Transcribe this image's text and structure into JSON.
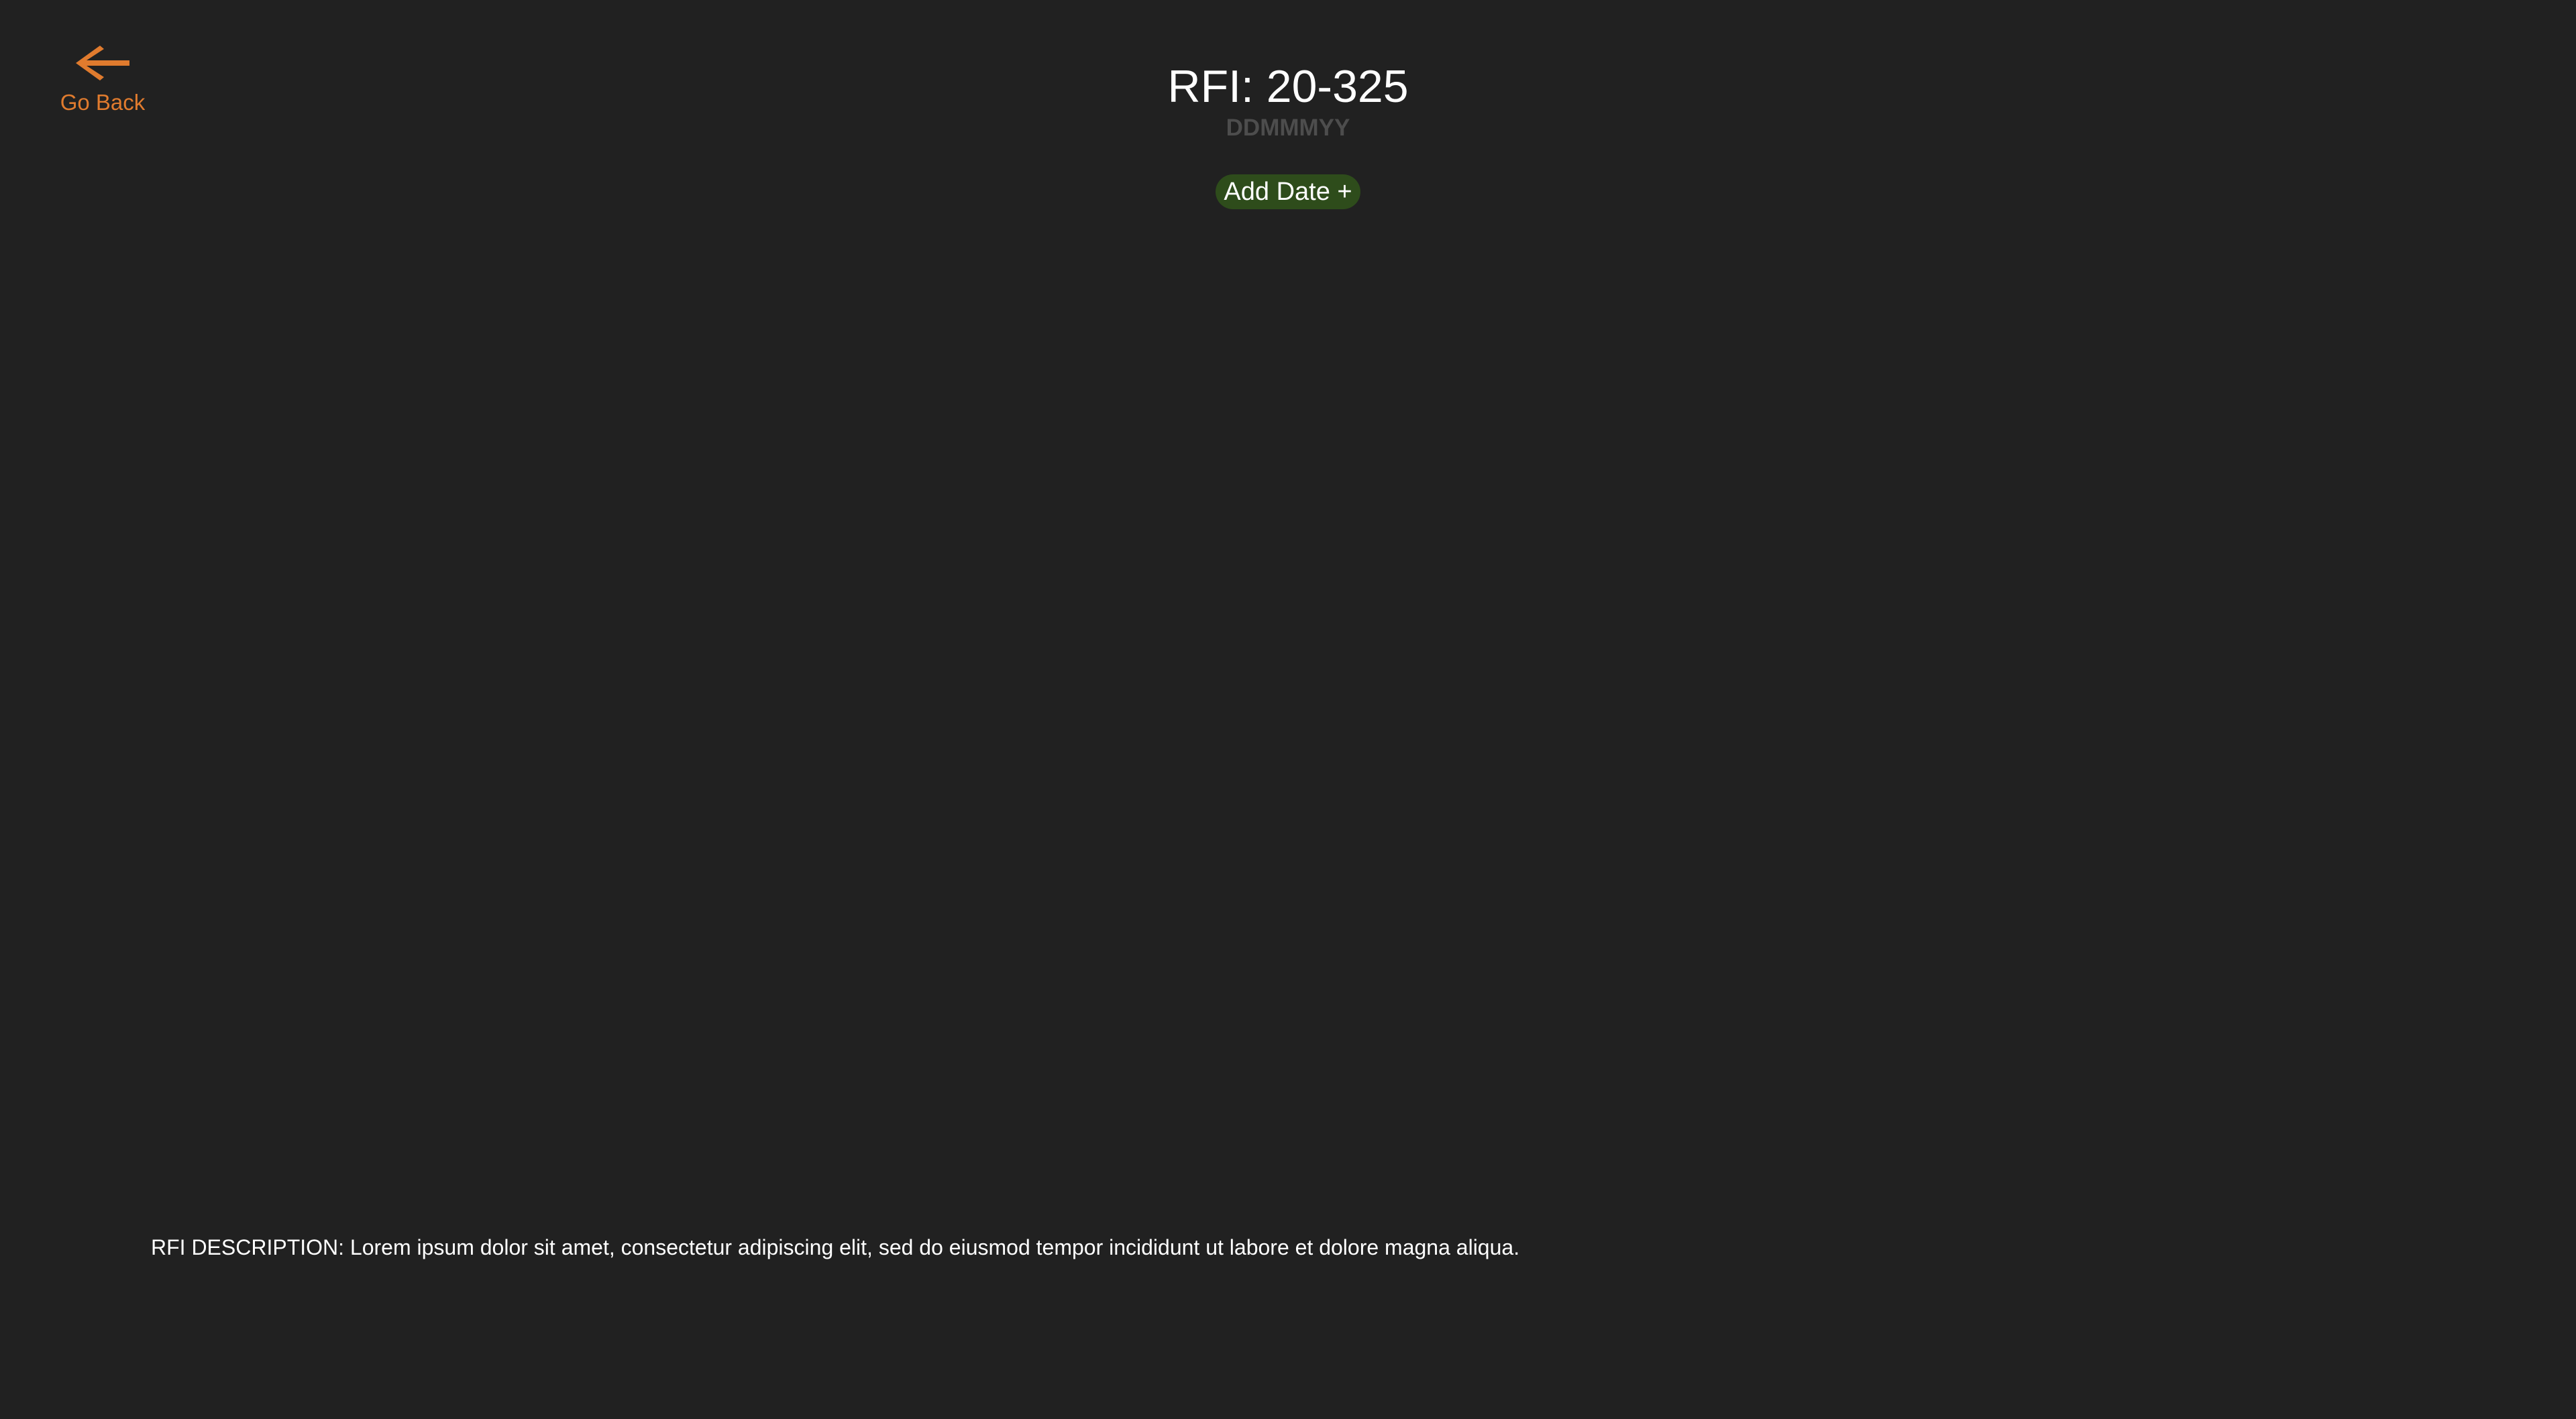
{
  "nav": {
    "back_label": "Go Back",
    "back_icon": "arrow-left-icon",
    "accent_color": "#e07b2e"
  },
  "header": {
    "title": "RFI: 20-325",
    "date_placeholder": "DDMMMYY",
    "add_date_label": "Add Date +"
  },
  "description": {
    "text": "RFI DESCRIPTION: Lorem ipsum dolor sit amet, consectetur adipiscing elit, sed do eiusmod tempor incididunt ut labore et dolore magna aliqua."
  },
  "colors": {
    "background": "#212121",
    "add_date_bg": "#2e4c1b",
    "date_text": "#4d4d4d"
  }
}
